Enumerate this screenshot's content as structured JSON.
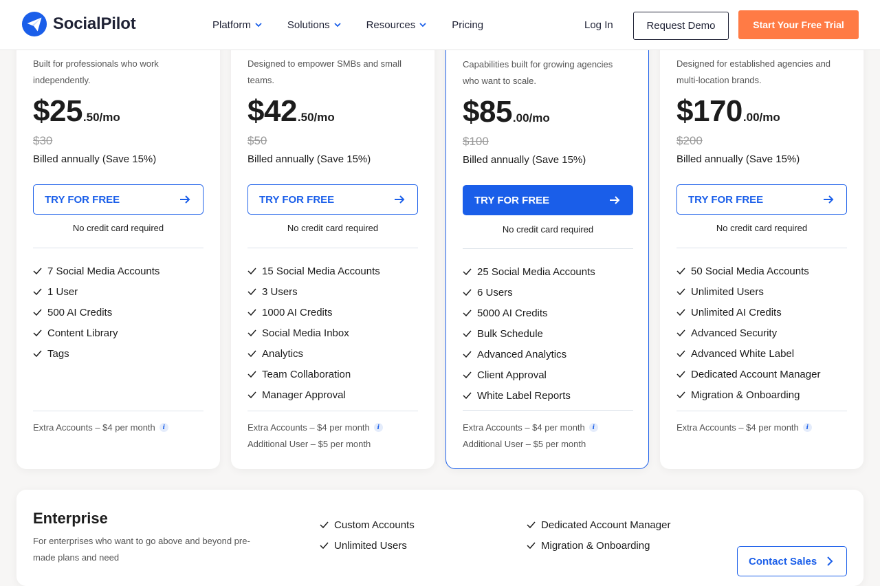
{
  "header": {
    "brand": "SocialPilot",
    "nav": [
      {
        "label": "Platform",
        "dropdown": true
      },
      {
        "label": "Solutions",
        "dropdown": true
      },
      {
        "label": "Resources",
        "dropdown": true
      },
      {
        "label": "Pricing",
        "dropdown": false
      }
    ],
    "login": "Log In",
    "demo": "Request Demo",
    "trial": "Start Your Free Trial"
  },
  "colors": {
    "accent": "#1a5ee9",
    "cta": "#ff7b45"
  },
  "plans": [
    {
      "description": "Built for professionals who work independently.",
      "price_main": "$25",
      "price_cents": ".50/mo",
      "old_price": "$30",
      "billed": "Billed annually (Save 15%)",
      "cta": "TRY FOR FREE",
      "no_cc": "No credit card required",
      "features": [
        "7 Social Media Accounts",
        "1 User",
        "500 AI Credits",
        "Content Library",
        "Tags"
      ],
      "extras": [
        "Extra Accounts – $4 per month"
      ]
    },
    {
      "description": "Designed to empower SMBs and small teams.",
      "price_main": "$42",
      "price_cents": ".50/mo",
      "old_price": "$50",
      "billed": "Billed annually (Save 15%)",
      "cta": "TRY FOR FREE",
      "no_cc": "No credit card required",
      "features": [
        "15 Social Media Accounts",
        "3 Users",
        "1000 AI Credits",
        "Social Media Inbox",
        "Analytics",
        "Team Collaboration",
        "Manager Approval"
      ],
      "extras": [
        "Extra Accounts – $4 per month",
        "Additional User – $5 per month"
      ]
    },
    {
      "description": "Capabilities built for growing agencies who want to scale.",
      "price_main": "$85",
      "price_cents": ".00/mo",
      "old_price": "$100",
      "billed": "Billed annually (Save 15%)",
      "cta": "TRY FOR FREE",
      "no_cc": "No credit card required",
      "features": [
        "25 Social Media Accounts",
        "6 Users",
        "5000 AI Credits",
        "Bulk Schedule",
        "Advanced Analytics",
        "Client Approval",
        "White Label Reports"
      ],
      "extras": [
        "Extra Accounts – $4 per month",
        "Additional User – $5 per month"
      ]
    },
    {
      "description": "Designed for established agencies and multi-location brands.",
      "price_main": "$170",
      "price_cents": ".00/mo",
      "old_price": "$200",
      "billed": "Billed annually (Save 15%)",
      "cta": "TRY FOR FREE",
      "no_cc": "No credit card required",
      "features": [
        "50 Social Media Accounts",
        "Unlimited Users",
        "Unlimited AI Credits",
        "Advanced Security",
        "Advanced White Label",
        "Dedicated Account Manager",
        "Migration & Onboarding"
      ],
      "extras": [
        "Extra Accounts – $4 per month"
      ]
    }
  ],
  "enterprise": {
    "title": "Enterprise",
    "description": "For enterprises who want to go above and beyond pre-made plans and need",
    "features_col1": [
      "Custom Accounts",
      "Unlimited Users"
    ],
    "features_col2": [
      "Dedicated Account Manager",
      "Migration & Onboarding"
    ],
    "cta": "Contact Sales"
  }
}
